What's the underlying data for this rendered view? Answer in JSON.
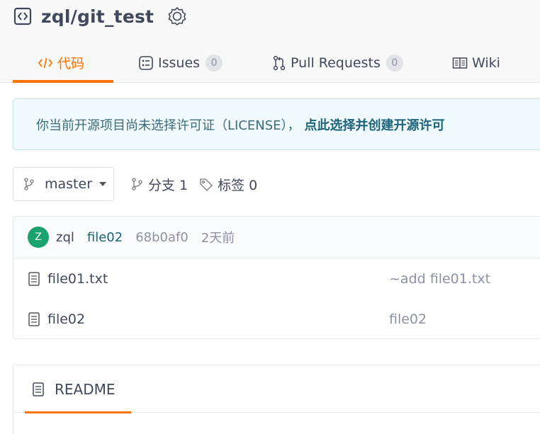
{
  "repo": {
    "name": "zql/git_test",
    "icon": "code-repo-icon",
    "badge_icon": "award-badge-icon"
  },
  "tabs": [
    {
      "label": "代码",
      "icon": "code-icon",
      "active": true
    },
    {
      "label": "Issues",
      "icon": "issues-icon",
      "count": "0"
    },
    {
      "label": "Pull Requests",
      "icon": "pull-request-icon",
      "count": "0"
    },
    {
      "label": "Wiki",
      "icon": "wiki-book-icon"
    }
  ],
  "license": {
    "text": "你当前开源项目尚未选择许可证（LICENSE），",
    "link": "点此选择并创建开源许可"
  },
  "branch": {
    "current": "master",
    "branches_label": "分支 1",
    "tags_label": "标签 0"
  },
  "commit": {
    "avatar_letter": "Z",
    "author": "zql",
    "message": "file02",
    "sha": "68b0af0",
    "time": "2天前"
  },
  "files": [
    {
      "name": "file01.txt",
      "commit": "~add file01.txt"
    },
    {
      "name": "file02",
      "commit": "file02"
    }
  ],
  "readme": {
    "title": "README"
  },
  "colors": {
    "accent": "#fe7300",
    "link": "#1b6378",
    "avatar": "#1aa36e"
  }
}
